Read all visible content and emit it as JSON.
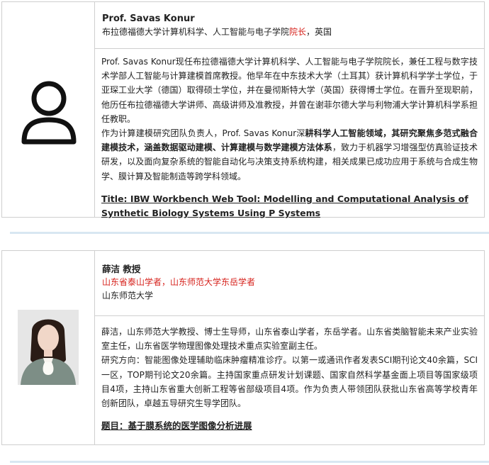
{
  "speakers": [
    {
      "name": "Prof. Savas Konur",
      "affiliation_prefix": "布拉德福德大学计算机科学、人工智能与电子学院",
      "affiliation_highlight": "院长",
      "affiliation_suffix": "，英国",
      "photo_icon": "person-outline-icon",
      "bio_p1": "Prof. Savas Konur现任布拉德福德大学计算机科学、人工智能与电子学院院长，兼任工程与数字技术学部人工智能与计算建模首席教授。他早年在中东技术大学（土耳其）获计算机科学学士学位，于亚琛工业大学（德国）取得硕士学位，并在曼彻斯特大学（英国）获得博士学位。在晋升至现职前，他历任布拉德福德大学讲师、高级讲师及准教授，并曾在谢菲尔德大学与利物浦大学计算机科学系担任教职。",
      "bio_p2_a": "作为计算建模研究团队负责人，Prof. Savas Konur深",
      "bio_p2_b": "耕科学人工智能领域，其研究聚焦多范式融合建模技术，涵盖数据驱动建模、计算建模与数学建模方法体系",
      "bio_p2_c": "，致力于机器学习增强型仿真验证技术研发，以及面向复杂系统的智能自动化与决策支持系统构建，相关成果已成功应用于系统与合成生物学、膜计算及智能制造等跨学科领域。",
      "talk_title": "Title: IBW Workbench Web Tool: Modelling and Computational Analysis of Synthetic Biology Systems Using P Systems"
    },
    {
      "name": "薛洁 教授",
      "honor": "山东省泰山学者，山东师范大学东岳学者",
      "institution": "山东师范大学",
      "bio_p1": "薛洁，山东师范大学教授、博士生导师，山东省泰山学者，东岳学者。山东省类脑智能未来产业实验室主任，山东省医学物理图像处理技术重点实验室副主任。",
      "bio_p2": "研究方向：智能图像处理辅助临床肿瘤精准诊疗。以第一或通讯作者发表SCI期刊论文40余篇，SCI一区，TOP期刊论文20余篇。主持国家重点研发计划课题、国家自然科学基金面上项目等国家级项目4项，主持山东省重大创新工程等省部级项目4项。作为负责人带领团队获批山东省高等学校青年创新团队，卓越五导研究生导学团队。",
      "talk_title": "题目：基于膜系统的医学图像分析进展"
    }
  ],
  "colors": {
    "accent_red": "#d6221c",
    "border": "#cfcfcf",
    "divider": "#d8e7f2"
  }
}
